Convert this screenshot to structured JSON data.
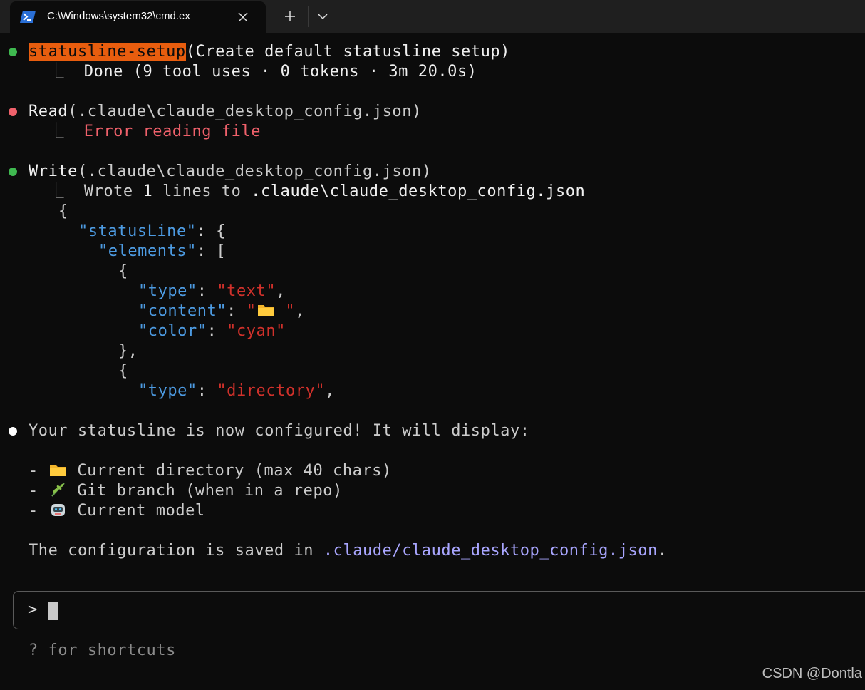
{
  "window": {
    "tab_title": "C:\\Windows\\system32\\cmd.ex",
    "icons": [
      "powershell-icon",
      "close-icon",
      "plus-icon",
      "chevron-down-icon"
    ]
  },
  "transcript": {
    "task": {
      "agent": "statusline-setup",
      "args": "(Create default statusline setup)",
      "result": "Done (9 tool uses · 0 tokens · 3m 20.0s)",
      "status_color": "#3fb950"
    },
    "read": {
      "tool": "Read",
      "args": "(.claude\\claude_desktop_config.json)",
      "result": "Error reading file",
      "status_color": "#f0616b"
    },
    "write": {
      "tool": "Write",
      "args": "(.claude\\claude_desktop_config.json)",
      "result_prefix": "Wrote ",
      "result_count": "1",
      "result_mid": " lines to ",
      "result_path": ".claude\\claude_desktop_config.json",
      "status_color": "#3fb950",
      "code": {
        "brace_open": "{",
        "statusline_key": "\"statusLine\"",
        "elements_key": "\"elements\"",
        "el1_type_key": "\"type\"",
        "el1_type_val": "\"text\"",
        "el1_content_key": "\"content\"",
        "el1_content_val_open": "\"",
        "el1_content_val_close": " \"",
        "el1_color_key": "\"color\"",
        "el1_color_val": "\"cyan\"",
        "el2_type_key": "\"type\"",
        "el2_type_val": "\"directory\""
      }
    },
    "message": {
      "intro": "Your statusline is now configured! It will display:",
      "items": [
        {
          "icon": "folder-icon",
          "text": "Current directory (max 40 chars)"
        },
        {
          "icon": "herb-icon",
          "text": "Git branch (when in a repo)"
        },
        {
          "icon": "robot-icon",
          "text": "Current model"
        }
      ],
      "saved_prefix": "The configuration is saved in ",
      "saved_path": ".claude/claude_desktop_config.json",
      "saved_suffix": "."
    }
  },
  "prompt": {
    "symbol": ">",
    "value": ""
  },
  "footer_hint": "? for shortcuts",
  "watermark": "CSDN @Dontla",
  "colors": {
    "background": "#0c0c0c",
    "agent_highlight": "#e85d0e",
    "json_key": "#4d9be2",
    "json_string": "#d0312b",
    "path": "#a9a6ff",
    "error": "#f0616b"
  }
}
